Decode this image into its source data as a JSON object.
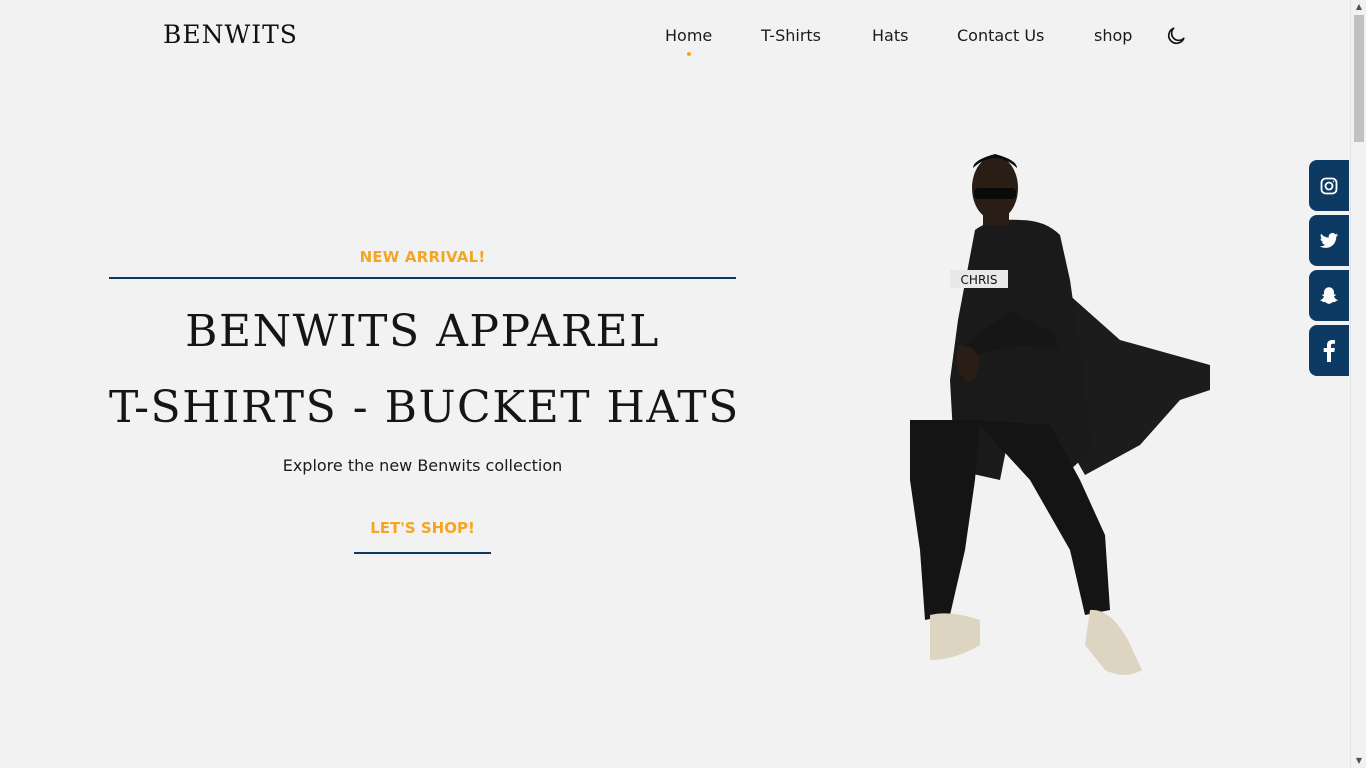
{
  "header": {
    "logo": "BENWITS",
    "nav": [
      "Home",
      "T-Shirts",
      "Hats",
      "Contact Us",
      "shop"
    ],
    "active_nav": "Home",
    "theme_toggle_icon": "moon-icon"
  },
  "social": [
    "instagram-icon",
    "twitter-icon",
    "snapchat-icon",
    "facebook-icon"
  ],
  "hero": {
    "eyebrow": "NEW ARRIVAL!",
    "title_line1": "BENWITS APPAREL",
    "title_line2": "T-SHIRTS - BUCKET HATS",
    "subtitle": "Explore the new Benwits collection",
    "cta": "LET'S SHOP!",
    "image": "model-photo"
  },
  "colors": {
    "accent": "#f5a524",
    "navy": "#0d3a63",
    "background": "#f2f2f2",
    "text": "#1b1b1b"
  }
}
